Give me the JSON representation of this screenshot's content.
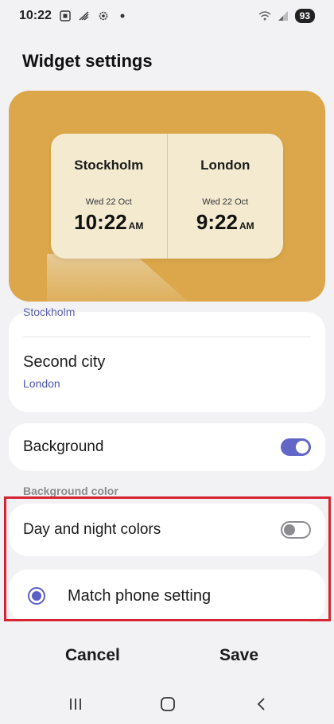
{
  "status_bar": {
    "time": "10:22",
    "battery": "93",
    "icons": [
      "screenshot-icon",
      "signal-off-icon",
      "settings-icon",
      "dot-icon",
      "wifi-icon",
      "signal-icon"
    ]
  },
  "page": {
    "title": "Widget settings"
  },
  "preview": {
    "background_color": "#dba74a",
    "cities": [
      {
        "name": "Stockholm",
        "date": "Wed 22 Oct",
        "time": "10:22",
        "ampm": "AM"
      },
      {
        "name": "London",
        "date": "Wed 22 Oct",
        "time": "9:22",
        "ampm": "AM"
      }
    ]
  },
  "settings": {
    "first_city_value": "Stockholm",
    "second_city_label": "Second city",
    "second_city_value": "London",
    "background_label": "Background",
    "background_enabled": true,
    "background_color_section": "Background color",
    "day_night_label": "Day and night colors",
    "day_night_enabled": false,
    "match_phone_label": "Match phone setting",
    "match_phone_selected": true,
    "accent_color": "#6266c9"
  },
  "footer": {
    "cancel_label": "Cancel",
    "save_label": "Save"
  },
  "nav": {
    "icons": [
      "recent-apps-icon",
      "home-icon",
      "back-icon"
    ]
  }
}
